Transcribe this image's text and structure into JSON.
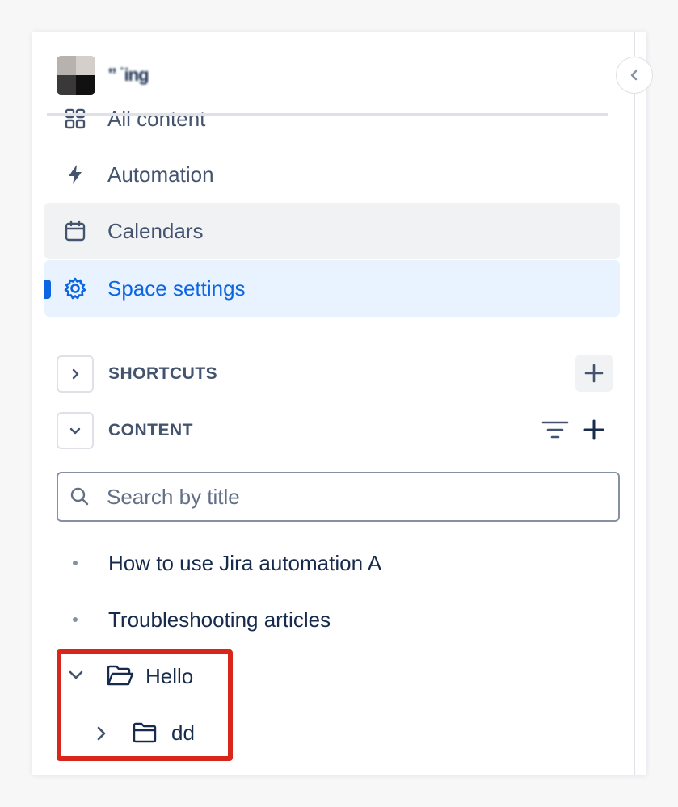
{
  "space": {
    "name": "'’ ˙ing"
  },
  "nav": {
    "items": [
      {
        "label": "All content",
        "icon": "grid-icon"
      },
      {
        "label": "Automation",
        "icon": "lightning-icon"
      },
      {
        "label": "Calendars",
        "icon": "calendar-icon"
      },
      {
        "label": "Space settings",
        "icon": "gear-icon"
      }
    ]
  },
  "sections": {
    "shortcuts": {
      "title": "SHORTCUTS"
    },
    "content": {
      "title": "CONTENT"
    }
  },
  "search": {
    "placeholder": "Search by title",
    "value": ""
  },
  "tree": {
    "items": [
      {
        "label": "How to use Jira automation A",
        "type": "page"
      },
      {
        "label": "Troubleshooting articles",
        "type": "page"
      },
      {
        "label": "Hello",
        "type": "folder",
        "expanded": true
      },
      {
        "label": "dd",
        "type": "folder",
        "expanded": false
      }
    ]
  },
  "colors": {
    "accent": "#0c66e4",
    "selected_bg": "#e9f2ff",
    "hover_bg": "#f1f2f4",
    "highlight": "#d9261c"
  }
}
